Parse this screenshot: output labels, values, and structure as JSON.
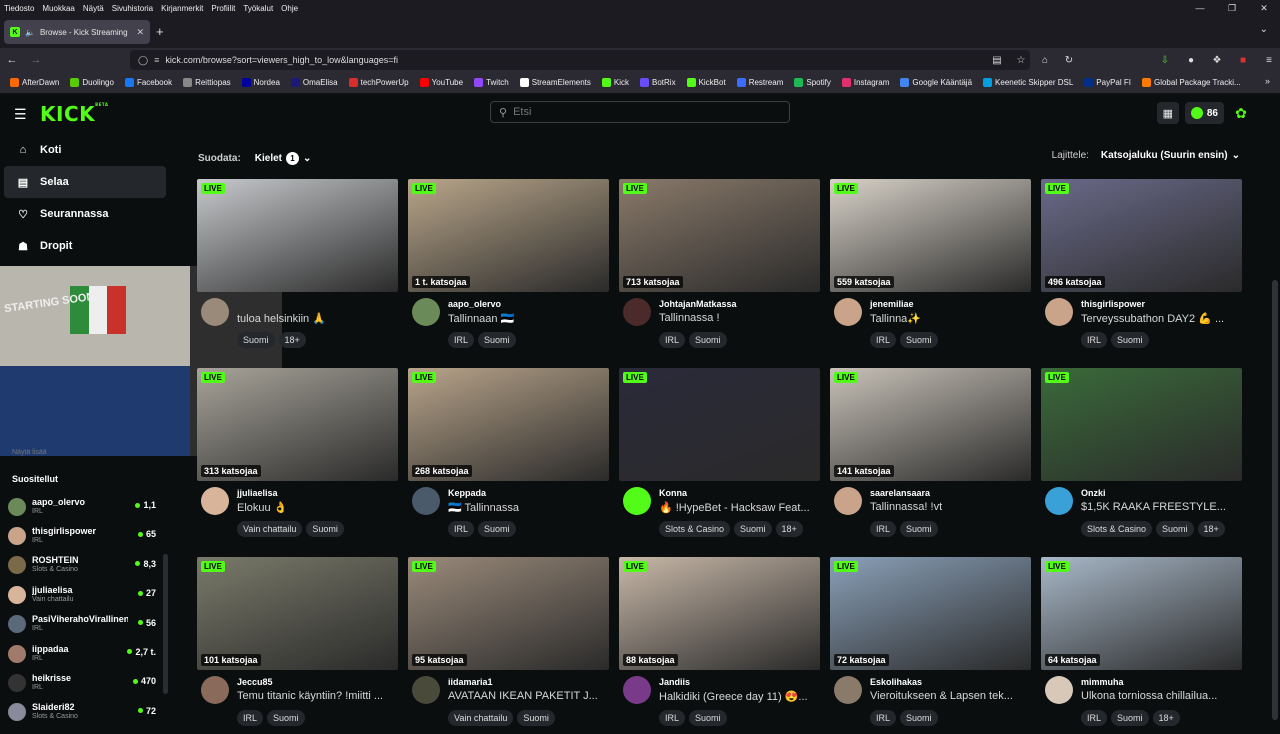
{
  "browser": {
    "menu": [
      "Tiedosto",
      "Muokkaa",
      "Näytä",
      "Sivuhistoria",
      "Kirjanmerkit",
      "Profiilit",
      "Työkalut",
      "Ohje"
    ],
    "tab_title": "Browse - Kick Streaming",
    "url": "kick.com/browse?sort=viewers_high_to_low&languages=fi",
    "bookmarks": [
      {
        "label": "AfterDawn",
        "color": "#ff6a00"
      },
      {
        "label": "Duolingo",
        "color": "#58cc02"
      },
      {
        "label": "Facebook",
        "color": "#1877f2"
      },
      {
        "label": "Reittiopas",
        "color": "#888888"
      },
      {
        "label": "Nordea",
        "color": "#0000a0"
      },
      {
        "label": "OmaElisa",
        "color": "#1a1a7a"
      },
      {
        "label": "techPowerUp",
        "color": "#d92d2d"
      },
      {
        "label": "YouTube",
        "color": "#ff0000"
      },
      {
        "label": "Twitch",
        "color": "#9146ff"
      },
      {
        "label": "StreamElements",
        "color": "#ffffff"
      },
      {
        "label": "Kick",
        "color": "#53fc18"
      },
      {
        "label": "BotRix",
        "color": "#6a4cff"
      },
      {
        "label": "KickBot",
        "color": "#53fc18"
      },
      {
        "label": "Restream",
        "color": "#3b6bff"
      },
      {
        "label": "Spotify",
        "color": "#1db954"
      },
      {
        "label": "Instagram",
        "color": "#e1306c"
      },
      {
        "label": "Google Kääntäjä",
        "color": "#4285f4"
      },
      {
        "label": "Keenetic Skipper DSL",
        "color": "#00a0e0"
      },
      {
        "label": "PayPal FI",
        "color": "#003087"
      },
      {
        "label": "Global Package Tracki...",
        "color": "#ff7a00"
      }
    ]
  },
  "kick": {
    "logo": "KICK",
    "logo_beta": "BETA",
    "search_placeholder": "Etsi",
    "kicks_count": "86",
    "nav": [
      {
        "label": "Koti",
        "icon": "home-icon"
      },
      {
        "label": "Selaa",
        "icon": "browse-icon"
      },
      {
        "label": "Seurannassa",
        "icon": "heart-icon"
      },
      {
        "label": "Dropit",
        "icon": "gift-icon"
      }
    ],
    "webcam_sign": "STARTING SOON",
    "show_more": "Näytä lisää",
    "followed_title": "Suositellut",
    "followed": [
      {
        "name": "aapo_olervo",
        "category": "IRL",
        "viewers": "1,1",
        "color": "#6a8a5a"
      },
      {
        "name": "thisgirlispower",
        "category": "IRL",
        "viewers": "65",
        "color": "#c9a38a"
      },
      {
        "name": "ROSHTEIN",
        "category": "Slots & Casino",
        "viewers": "8,3",
        "color": "#7a6a4a"
      },
      {
        "name": "jjuliaelisa",
        "category": "Vain chattailu",
        "viewers": "27",
        "color": "#d8b59a"
      },
      {
        "name": "PasiViherahoVirallinen",
        "category": "IRL",
        "viewers": "56",
        "color": "#5a6a7a"
      },
      {
        "name": "iippadaa",
        "category": "IRL",
        "viewers": "2,7 t.",
        "color": "#a07a6a"
      },
      {
        "name": "heikrisse",
        "category": "IRL",
        "viewers": "470",
        "color": "#333333"
      },
      {
        "name": "Slaideri82",
        "category": "Slots & Casino",
        "viewers": "72",
        "color": "#8a8a9a"
      }
    ],
    "filter_label": "Suodata:",
    "filter_button": "Kielet",
    "filter_count": "1",
    "sort_label": "Lajittele:",
    "sort_value": "Katsojaluku (Suurin ensin)",
    "live_label": "LIVE",
    "streams": [
      {
        "name": "",
        "title": "tuloa helsinkiin 🙏",
        "viewers": "",
        "tags": [
          "Suomi",
          "18+"
        ],
        "scene": "#c7c9cc",
        "av": "#9a8a7a"
      },
      {
        "name": "aapo_olervo",
        "title": "Tallinnaan 🇪🇪",
        "viewers": "1 t. katsojaa",
        "tags": [
          "IRL",
          "Suomi"
        ],
        "scene": "#b9a68a",
        "av": "#6a8a5a"
      },
      {
        "name": "JohtajanMatkassa",
        "title": "Tallinnassa !",
        "viewers": "713 katsojaa",
        "tags": [
          "IRL",
          "Suomi"
        ],
        "scene": "#8a7a6a",
        "av": "#4a2a2a"
      },
      {
        "name": "jenemiliae",
        "title": "Tallinna✨",
        "viewers": "559 katsojaa",
        "tags": [
          "IRL",
          "Suomi"
        ],
        "scene": "#d8d2c8",
        "av": "#c9a38a"
      },
      {
        "name": "thisgirlispower",
        "title": "Terveyssubathon DAY2 💪 ...",
        "viewers": "496 katsojaa",
        "tags": [
          "IRL",
          "Suomi"
        ],
        "scene": "#6a6a8a",
        "av": "#c9a38a"
      },
      {
        "name": "jjuliaelisa",
        "title": "Elokuu 👌",
        "viewers": "313 katsojaa",
        "tags": [
          "Vain chattailu",
          "Suomi"
        ],
        "scene": "#a8a49a",
        "av": "#d8b59a"
      },
      {
        "name": "Keppada",
        "title": "🇪🇪 Tallinnassa",
        "viewers": "268 katsojaa",
        "tags": [
          "IRL",
          "Suomi"
        ],
        "scene": "#b8a48a",
        "av": "#4a5a6a"
      },
      {
        "name": "Konna",
        "title": "🔥 !HypeBet - Hacksaw Feat...",
        "viewers": "",
        "tags": [
          "Slots & Casino",
          "Suomi",
          "18+"
        ],
        "scene": "#2a2a3a",
        "av": "#53fc18"
      },
      {
        "name": "saarelansaara",
        "title": "Tallinnassa! !vt",
        "viewers": "141 katsojaa",
        "tags": [
          "IRL",
          "Suomi"
        ],
        "scene": "#c8c2b8",
        "av": "#c9a38a"
      },
      {
        "name": "Onzki",
        "title": "$1,5K RAAKA FREESTYLE...",
        "viewers": "",
        "tags": [
          "Slots & Casino",
          "Suomi",
          "18+"
        ],
        "scene": "#3a6a3a",
        "av": "#3aa0d8"
      },
      {
        "name": "Jeccu85",
        "title": "Temu titanic käyntiin? !miitti ...",
        "viewers": "101 katsojaa",
        "tags": [
          "IRL",
          "Suomi"
        ],
        "scene": "#7a7a6a",
        "av": "#8a6a5a"
      },
      {
        "name": "iidamaria1",
        "title": "AVATAAN IKEAN PAKETIT J...",
        "viewers": "95 katsojaa",
        "tags": [
          "Vain chattailu",
          "Suomi"
        ],
        "scene": "#9a8a7a",
        "av": "#4a4a3a"
      },
      {
        "name": "Jandiis",
        "title": "Halkidiki (Greece day 11) 😍...",
        "viewers": "88 katsojaa",
        "tags": [
          "IRL",
          "Suomi"
        ],
        "scene": "#c8b8a8",
        "av": "#7a3a8a"
      },
      {
        "name": "Eskolihakas",
        "title": "Vieroitukseen & Lapsen tek...",
        "viewers": "72 katsojaa",
        "tags": [
          "IRL",
          "Suomi"
        ],
        "scene": "#8aa0b8",
        "av": "#8a7a6a"
      },
      {
        "name": "mimmuha",
        "title": "Ulkona torniossa chillailua...",
        "viewers": "64 katsojaa",
        "tags": [
          "IRL",
          "Suomi",
          "18+"
        ],
        "scene": "#a8b8c8",
        "av": "#d8c8b8"
      }
    ]
  }
}
